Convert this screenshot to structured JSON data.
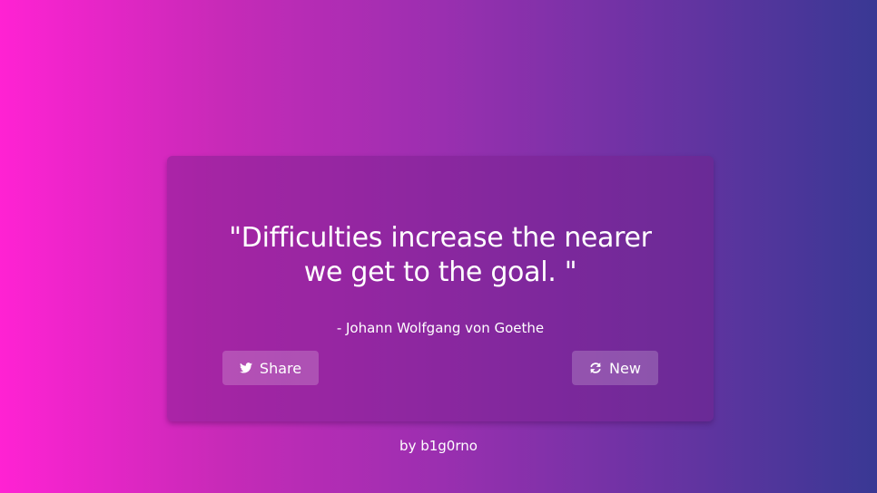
{
  "quote_card": {
    "quote_line1": "\"Difficulties increase the nearer",
    "quote_line2": "we get to the goal. \"",
    "author": "- Johann Wolfgang von Goethe",
    "share_label": "Share",
    "new_label": "New",
    "share_icon": "twitter-icon",
    "new_icon": "refresh-icon"
  },
  "footer": {
    "credit": "by b1g0rno"
  },
  "colors": {
    "gradient_left": "#ff22d3",
    "gradient_right": "#393894",
    "text": "#ffffff"
  }
}
